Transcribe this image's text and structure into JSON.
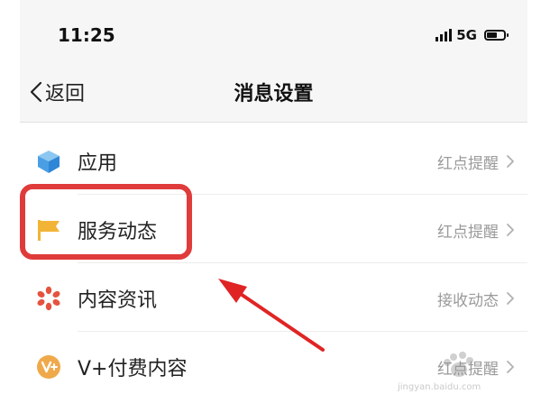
{
  "status_bar": {
    "time": "11:25",
    "network": "5G"
  },
  "nav": {
    "back_label": "返回",
    "title": "消息设置"
  },
  "rows": [
    {
      "label": "应用",
      "value": "红点提醒",
      "icon": "cube-icon"
    },
    {
      "label": "服务动态",
      "value": "红点提醒",
      "icon": "flag-icon"
    },
    {
      "label": "内容资讯",
      "value": "接收动态",
      "icon": "flower-icon"
    },
    {
      "label": "V+付费内容",
      "value": "红点提醒",
      "icon": "vplus-icon"
    }
  ],
  "watermark": {
    "text": "jingyan.baidu.com"
  },
  "colors": {
    "highlight": "#e03b3b",
    "flag": "#f2b437",
    "cube": "#4a9fe4",
    "flower": "#e5533f",
    "vplus": "#f0a94a"
  }
}
